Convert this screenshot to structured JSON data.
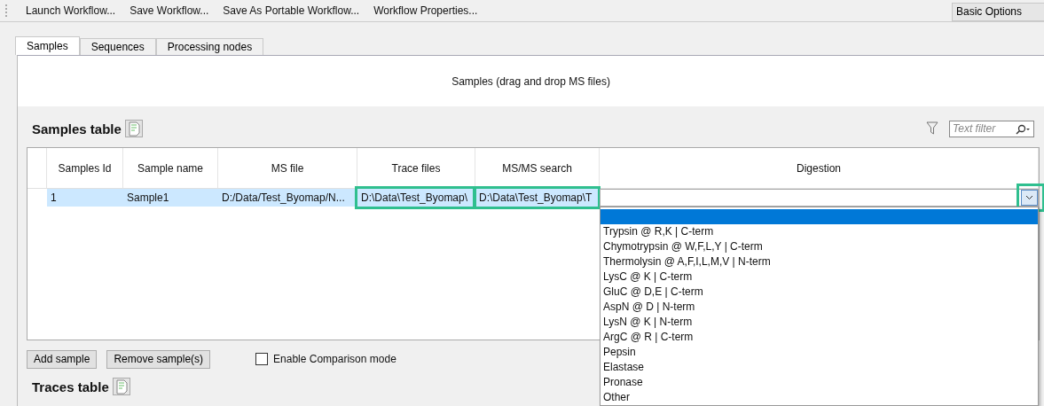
{
  "toolbar": {
    "items": [
      "Launch Workflow...",
      "Save Workflow...",
      "Save As Portable Workflow...",
      "Workflow Properties..."
    ],
    "options_button": "Basic Options"
  },
  "tabs": [
    {
      "label": "Samples",
      "selected": true
    },
    {
      "label": "Sequences",
      "selected": false
    },
    {
      "label": "Processing nodes",
      "selected": false
    }
  ],
  "drop_hint": "Samples (drag and drop MS files)",
  "samples_table": {
    "title": "Samples table",
    "filter_placeholder": "Text filter",
    "columns": [
      "Samples Id",
      "Sample name",
      "MS file",
      "Trace files",
      "MS/MS search",
      "Digestion"
    ],
    "rows": [
      {
        "selected": true,
        "cells": [
          {
            "text": "1",
            "highlighted": false
          },
          {
            "text": "Sample1",
            "highlighted": false
          },
          {
            "text": "D:/Data/Test_Byomap/N...",
            "highlighted": false
          },
          {
            "text": "D:\\Data\\Test_Byomap\\",
            "highlighted": true
          },
          {
            "text": "D:\\Data\\Test_Byomap\\T",
            "highlighted": true
          }
        ]
      }
    ],
    "digestion_dropdown": {
      "expanded": true,
      "button_highlighted": true,
      "blank_option": {
        "selected": true
      },
      "options": [
        {
          "label": "Trypsin @ R,K | C-term",
          "selected": false
        },
        {
          "label": "Chymotrypsin @ W,F,L,Y | C-term",
          "selected": false
        },
        {
          "label": "Thermolysin @ A,F,I,L,M,V | N-term",
          "selected": false
        },
        {
          "label": "LysC @ K | C-term",
          "selected": false
        },
        {
          "label": "GluC @ D,E | C-term",
          "selected": false
        },
        {
          "label": "AspN @ D | N-term",
          "selected": false
        },
        {
          "label": "LysN @ K | N-term",
          "selected": false
        },
        {
          "label": "ArgC @ R | C-term",
          "selected": false
        },
        {
          "label": "Pepsin",
          "selected": false
        },
        {
          "label": "Elastase",
          "selected": false
        },
        {
          "label": "Pronase",
          "selected": false
        },
        {
          "label": "Other",
          "selected": false
        }
      ]
    }
  },
  "buttons": [
    "Add sample",
    "Remove sample(s)"
  ],
  "comparison_checkbox": {
    "label": "Enable Comparison mode",
    "checked": false
  },
  "traces_table": {
    "title": "Traces table"
  }
}
